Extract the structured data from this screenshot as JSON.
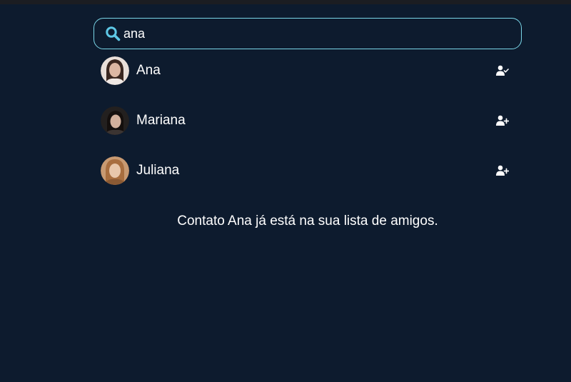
{
  "search": {
    "value": "ana",
    "icon": "search-icon",
    "border_color": "#7ad6e8",
    "icon_color": "#5ec8e6"
  },
  "contacts": [
    {
      "name": "Ana",
      "action_icon": "user-check-icon",
      "is_friend": true
    },
    {
      "name": "Mariana",
      "action_icon": "user-plus-icon",
      "is_friend": false
    },
    {
      "name": "Juliana",
      "action_icon": "user-plus-icon",
      "is_friend": false
    }
  ],
  "status_message": "Contato Ana já está na sua lista de amigos.",
  "colors": {
    "background": "#0d1b2e",
    "text": "#ffffff"
  }
}
